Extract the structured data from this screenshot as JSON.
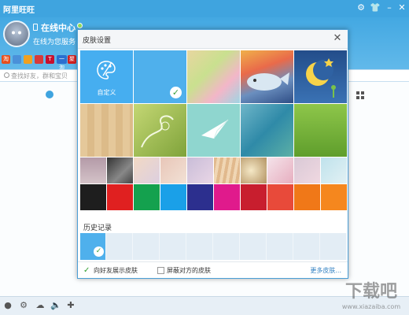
{
  "window": {
    "title": "阿里旺旺"
  },
  "user": {
    "name": "在线中心",
    "signature": "在线为您服务"
  },
  "search": {
    "placeholder": "查找好友，群和宝贝"
  },
  "dialog": {
    "title": "皮肤设置",
    "close_icon": "close-icon",
    "custom_label": "自定义",
    "history_title": "历史记录",
    "show_friends_label": "向好友展示皮肤",
    "block_others_label": "屏蔽对方的皮肤",
    "more_skins_label": "更多皮肤...",
    "show_friends_checked": true,
    "block_others_checked": false
  },
  "solid_colors": [
    "#1e1e1e",
    "#e02020",
    "#14a14e",
    "#1aa0e8",
    "#2c2f8e",
    "#e01a8c",
    "#c81e2e",
    "#e84a3a",
    "#f07818",
    "#f5871e"
  ],
  "app_icons": [
    {
      "name": "taobao-icon",
      "color": "#e8501e",
      "text": "淘"
    },
    {
      "name": "mail-icon",
      "color": "#4a90d9",
      "text": ""
    },
    {
      "name": "shop-icon",
      "color": "#f0a020",
      "text": ""
    },
    {
      "name": "gift-icon",
      "color": "#d83a3a",
      "text": ""
    },
    {
      "name": "tmall-icon",
      "color": "#c8102e",
      "text": "T"
    },
    {
      "name": "yitao-icon",
      "color": "#2a6fd0",
      "text": "一淘"
    },
    {
      "name": "jusuan-icon",
      "color": "#d02020",
      "text": "聚"
    }
  ],
  "watermark": {
    "text": "下载吧",
    "sub": "www.xiazaiba.com"
  }
}
